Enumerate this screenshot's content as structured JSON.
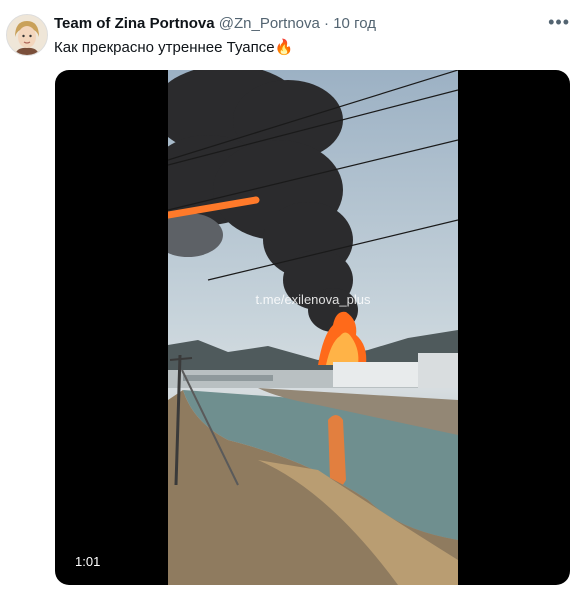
{
  "tweet": {
    "display_name": "Team of Zina Portnova",
    "handle": "@Zn_Portnova",
    "separator": "·",
    "time": "10 год",
    "text": "Как прекрасно утреннее Туапсе",
    "emoji": "🔥",
    "more_icon": "more-dots-icon"
  },
  "video": {
    "watermark": "t.me/exilenova_plus",
    "duration": "1:01"
  },
  "colors": {
    "name": "#0f1419",
    "meta": "#536471",
    "smoke": "#2b2b2d",
    "fire": "#ff6a1a"
  }
}
